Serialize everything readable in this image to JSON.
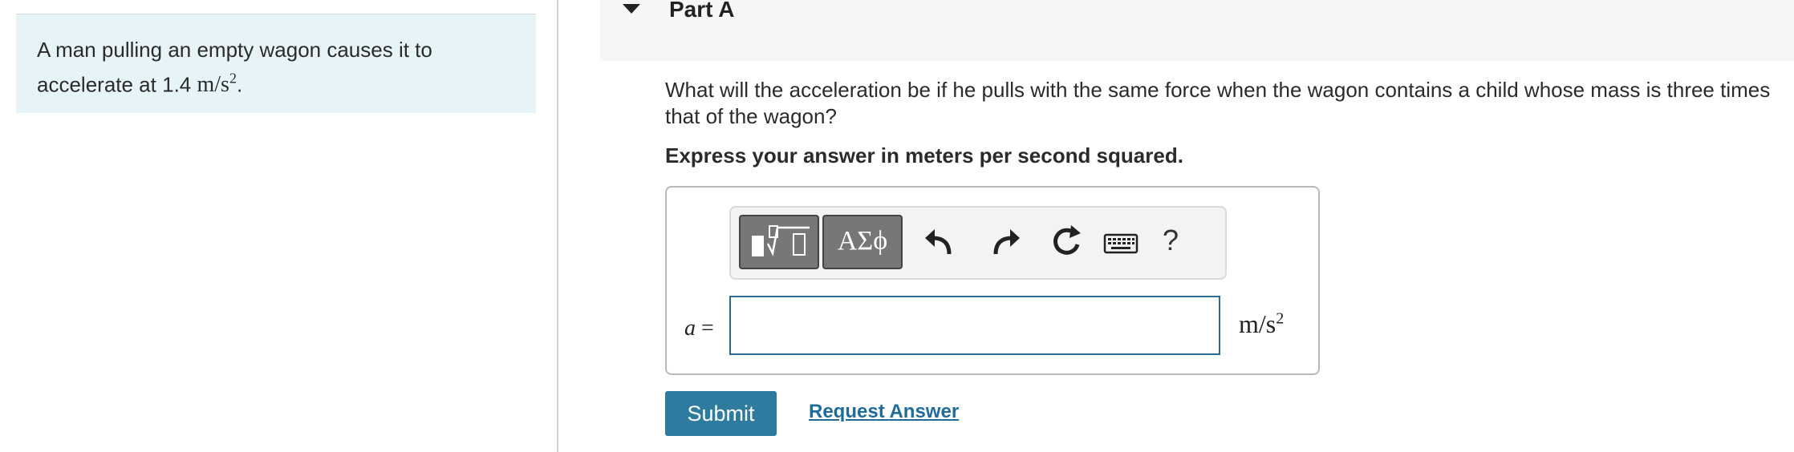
{
  "problem": {
    "text": "A man pulling an empty wagon causes it to accelerate at",
    "value": "1.4",
    "unit_num": "m/s",
    "unit_exp": "2",
    "end": "."
  },
  "part": {
    "title": "Part A",
    "question": "What will the acceleration be if he pulls with the same force when the wagon contains a child whose mass is three times that of the wagon?",
    "instruction": "Express your answer in meters per second squared."
  },
  "toolbar": {
    "greek_label": "ΑΣϕ",
    "help_label": "?"
  },
  "answer": {
    "variable_label": "a",
    "equals": "=",
    "value": "",
    "unit_num": "m/s",
    "unit_exp": "2"
  },
  "actions": {
    "submit_label": "Submit",
    "request_answer_label": "Request Answer"
  },
  "colors": {
    "problem_bg": "#e6f4f7",
    "submit_bg": "#2e7ba0",
    "link": "#1f6c9c",
    "input_border": "#2a6f8a"
  }
}
